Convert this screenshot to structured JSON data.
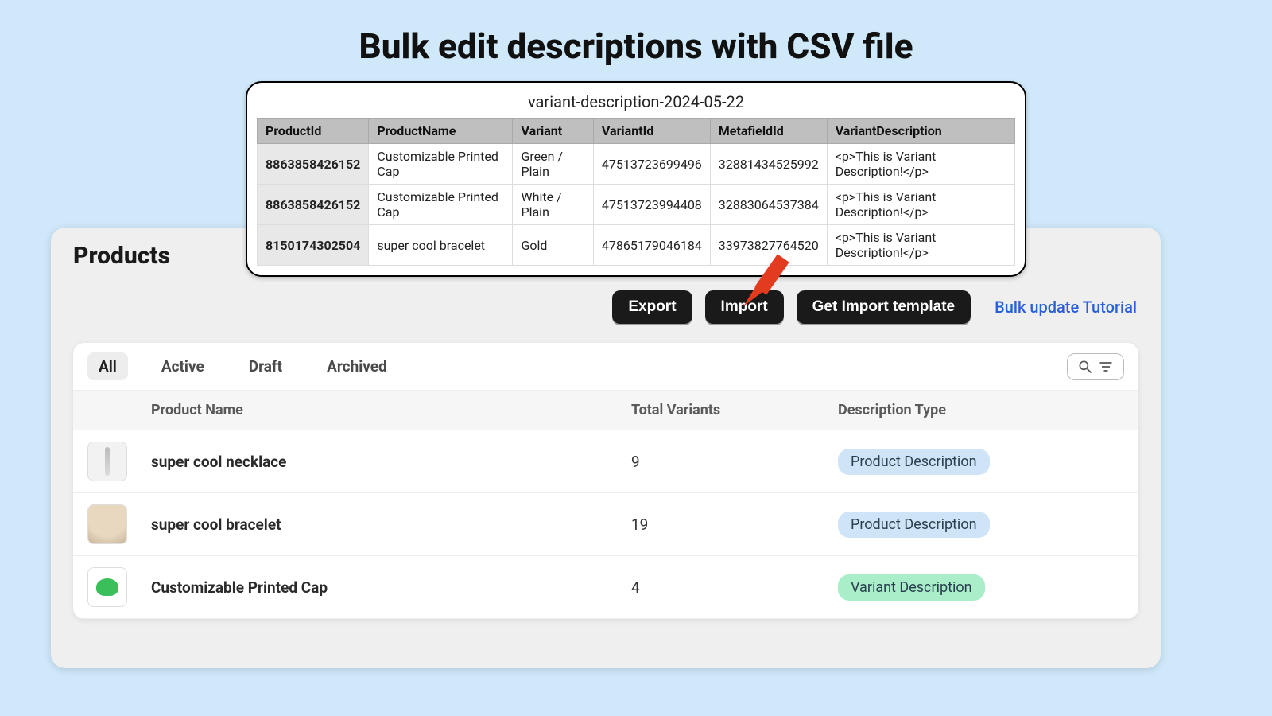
{
  "page": {
    "title": "Bulk edit descriptions with CSV file"
  },
  "csv": {
    "filename": "variant-description-2024-05-22",
    "headers": [
      "ProductId",
      "ProductName",
      "Variant",
      "VariantId",
      "MetafieldId",
      "VariantDescription"
    ],
    "rows": [
      {
        "product_id": "8863858426152",
        "product_name": "Customizable Printed Cap",
        "variant": "Green / Plain",
        "variant_id": "47513723699496",
        "metafield_id": "32881434525992",
        "description": "<p>This is Variant Description!</p>"
      },
      {
        "product_id": "8863858426152",
        "product_name": "Customizable Printed Cap",
        "variant": "White / Plain",
        "variant_id": "47513723994408",
        "metafield_id": "32883064537384",
        "description": "<p>This is Variant Description!</p>"
      },
      {
        "product_id": "8150174302504",
        "product_name": "super cool bracelet",
        "variant": "Gold",
        "variant_id": "47865179046184",
        "metafield_id": "33973827764520",
        "description": "<p>This is Variant Description!</p>"
      }
    ]
  },
  "products": {
    "heading": "Products",
    "buttons": {
      "export": "Export",
      "import": "Import",
      "template": "Get Import template"
    },
    "tutorial_link": "Bulk update Tutorial",
    "tabs": {
      "all": "All",
      "active": "Active",
      "draft": "Draft",
      "archived": "Archived"
    },
    "columns": {
      "name": "Product Name",
      "variants": "Total Variants",
      "desc_type": "Description Type"
    },
    "items": [
      {
        "name": "super cool necklace",
        "total_variants": "9",
        "desc_type": "Product Description",
        "badge": "product",
        "thumb": "necklace"
      },
      {
        "name": "super cool bracelet",
        "total_variants": "19",
        "desc_type": "Product Description",
        "badge": "product",
        "thumb": "bracelet"
      },
      {
        "name": "Customizable Printed Cap",
        "total_variants": "4",
        "desc_type": "Variant Description",
        "badge": "variant",
        "thumb": "cap"
      }
    ]
  }
}
